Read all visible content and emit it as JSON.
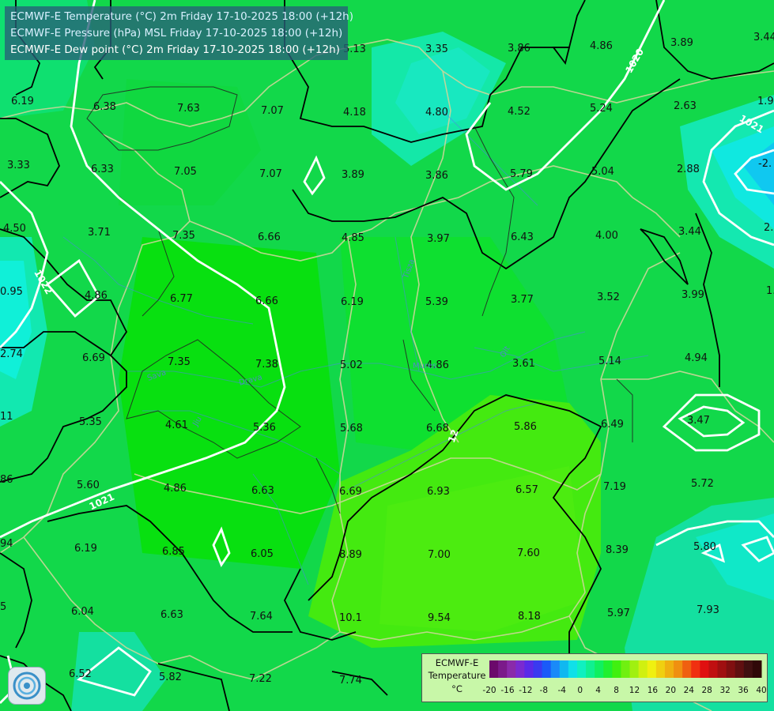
{
  "header": {
    "line1": "ECMWF-E Temperature (°C) 2m Friday 17-10-2025 18:00 (+12h)",
    "line2": "ECMWF-E Pressure (hPa) MSL Friday 17-10-2025 18:00 (+12h)",
    "line3": "ECMWF-E Dew point (°C) 2m Friday 17-10-2025 18:00 (+12h)"
  },
  "legend": {
    "title1": "ECMWF-E",
    "title2": "Temperature",
    "unit": "°C",
    "ticks": [
      "-20",
      "-16",
      "-12",
      "-8",
      "-4",
      "0",
      "4",
      "8",
      "12",
      "16",
      "20",
      "24",
      "28",
      "32",
      "36",
      "40"
    ],
    "colors": [
      "#6b0a6b",
      "#7b1a8a",
      "#8a2aaa",
      "#7a2ad0",
      "#5a2ae8",
      "#3a3af0",
      "#1a5af8",
      "#1a8af8",
      "#10b8f0",
      "#10e0e8",
      "#10f0c0",
      "#10f090",
      "#10f060",
      "#20f030",
      "#40f010",
      "#70f010",
      "#a0f010",
      "#d0f010",
      "#f0f010",
      "#f0d010",
      "#f0b010",
      "#f09010",
      "#f06010",
      "#f03010",
      "#e01010",
      "#c01010",
      "#a01010",
      "#801010",
      "#601010",
      "#401010",
      "#300808"
    ]
  },
  "isobars": {
    "labels": [
      "1020",
      "1021",
      "1022",
      "1021",
      "12"
    ]
  },
  "rivers": [
    "Sava",
    "Drava",
    "Tisza",
    "Mures",
    "Olt",
    "Dunav",
    "Jiu",
    "Siret"
  ],
  "values": [
    {
      "t": "6.19"
    },
    {
      "t": "6.38"
    },
    {
      "t": "7.63"
    },
    {
      "t": "7.07"
    },
    {
      "t": "5.13"
    },
    {
      "t": "3.35"
    },
    {
      "t": "3.86"
    },
    {
      "t": "4.86"
    },
    {
      "t": "3.89"
    },
    {
      "t": "3.44"
    },
    {
      "t": "4.18"
    },
    {
      "t": "4.80"
    },
    {
      "t": "4.52"
    },
    {
      "t": "5.24"
    },
    {
      "t": "2.63"
    },
    {
      "t": "1.9"
    },
    {
      "t": "3.33"
    },
    {
      "t": "6.33"
    },
    {
      "t": "7.05"
    },
    {
      "t": "7.07"
    },
    {
      "t": "3.89"
    },
    {
      "t": "3.86"
    },
    {
      "t": "5.79"
    },
    {
      "t": "5.04"
    },
    {
      "t": "2.88"
    },
    {
      "t": "-2."
    },
    {
      "t": "4.50"
    },
    {
      "t": "3.71"
    },
    {
      "t": "7.35"
    },
    {
      "t": "6.66"
    },
    {
      "t": "4.85"
    },
    {
      "t": "3.97"
    },
    {
      "t": "6.43"
    },
    {
      "t": "4.00"
    },
    {
      "t": "3.44"
    },
    {
      "t": "2."
    },
    {
      "t": "0.95"
    },
    {
      "t": "4.86"
    },
    {
      "t": "6.77"
    },
    {
      "t": "6.66"
    },
    {
      "t": "6.19"
    },
    {
      "t": "5.39"
    },
    {
      "t": "3.77"
    },
    {
      "t": "3.52"
    },
    {
      "t": "3.99"
    },
    {
      "t": "1."
    },
    {
      "t": "2.74"
    },
    {
      "t": "6.69"
    },
    {
      "t": "7.35"
    },
    {
      "t": "7.38"
    },
    {
      "t": "5.02"
    },
    {
      "t": "4.86"
    },
    {
      "t": "3.61"
    },
    {
      "t": "5.14"
    },
    {
      "t": "4.94"
    },
    {
      "t": "11"
    },
    {
      "t": "5.35"
    },
    {
      "t": "4.61"
    },
    {
      "t": "5.36"
    },
    {
      "t": "5.68"
    },
    {
      "t": "6.68"
    },
    {
      "t": "5.86"
    },
    {
      "t": "6.49"
    },
    {
      "t": "3.47"
    },
    {
      "t": "86"
    },
    {
      "t": "5.60"
    },
    {
      "t": "4.86"
    },
    {
      "t": "6.63"
    },
    {
      "t": "6.69"
    },
    {
      "t": "6.93"
    },
    {
      "t": "6.57"
    },
    {
      "t": "7.19"
    },
    {
      "t": "5.72"
    },
    {
      "t": "94"
    },
    {
      "t": "6.19"
    },
    {
      "t": "6.85"
    },
    {
      "t": "6.05"
    },
    {
      "t": "8.89"
    },
    {
      "t": "7.00"
    },
    {
      "t": "7.60"
    },
    {
      "t": "8.39"
    },
    {
      "t": "5.80"
    },
    {
      "t": "5"
    },
    {
      "t": "6.04"
    },
    {
      "t": "6.63"
    },
    {
      "t": "7.64"
    },
    {
      "t": "10.1"
    },
    {
      "t": "9.54"
    },
    {
      "t": "8.18"
    },
    {
      "t": "5.97"
    },
    {
      "t": "7.93"
    },
    {
      "t": "6.52"
    },
    {
      "t": "5.82"
    },
    {
      "t": "7.22"
    },
    {
      "t": "7.74"
    }
  ]
}
